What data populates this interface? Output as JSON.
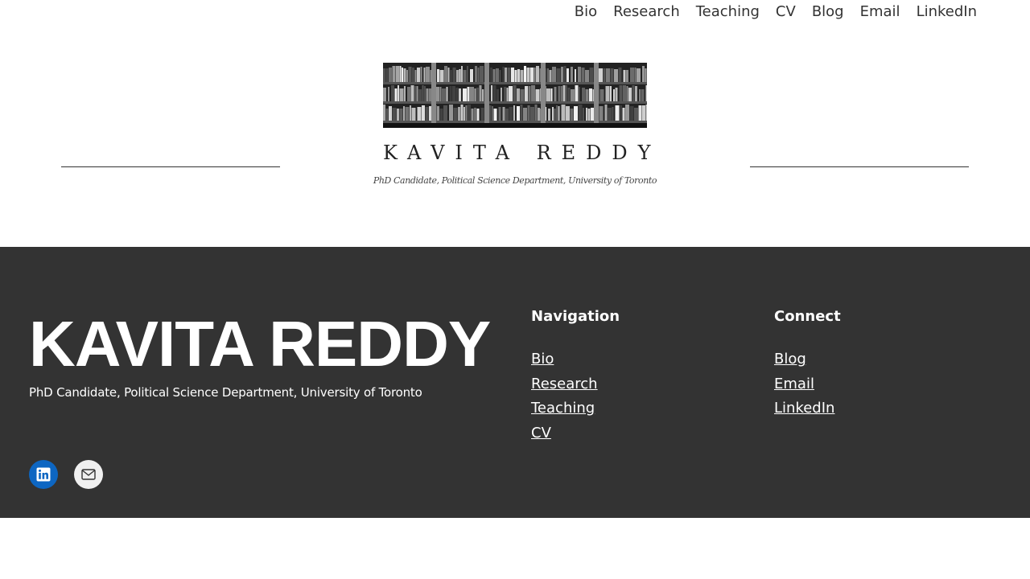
{
  "top_nav": [
    "Bio",
    "Research",
    "Teaching",
    "CV",
    "Blog",
    "Email",
    "LinkedIn"
  ],
  "hero": {
    "name": "KAVITA REDDY",
    "tagline": "PhD Candidate, Political Science Department, University of Toronto"
  },
  "footer": {
    "name": "KAVITA REDDY",
    "tagline": "PhD Candidate, Political Science Department, University of Toronto",
    "navigation": {
      "heading": "Navigation",
      "links": [
        "Bio",
        "Research",
        "Teaching",
        "CV"
      ]
    },
    "connect": {
      "heading": "Connect",
      "links": [
        "Blog",
        "Email",
        "LinkedIn"
      ]
    },
    "socials": [
      "linkedin-icon",
      "mail-icon"
    ]
  },
  "colors": {
    "footer_bg": "#333333",
    "linkedin": "#0d66c2"
  }
}
